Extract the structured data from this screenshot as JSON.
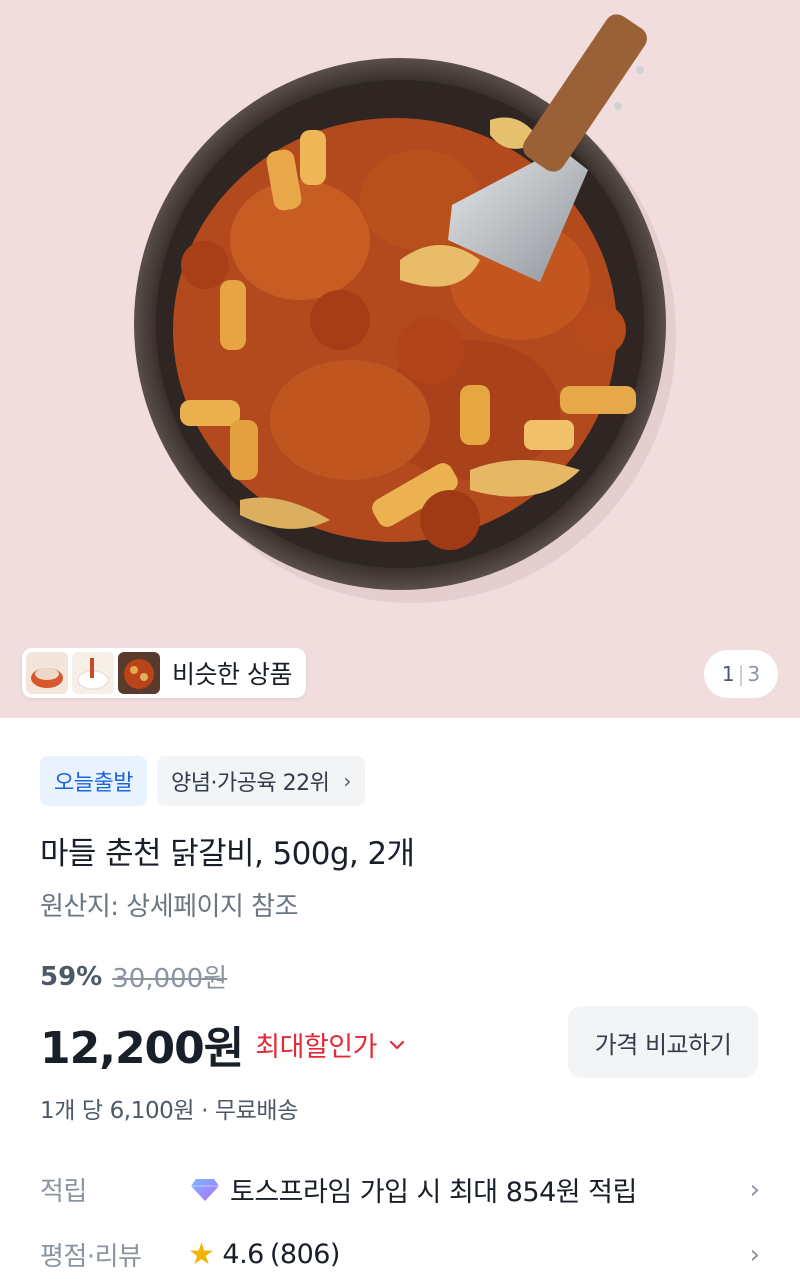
{
  "hero": {
    "similar_label": "비슷한 상품",
    "pager": {
      "current": "1",
      "separator": "|",
      "total": "3"
    }
  },
  "badges": {
    "today": "오늘출발",
    "rank": "양념·가공육 22위",
    "rank_chevron": "›"
  },
  "product": {
    "title": "마들 춘천 닭갈비, 500g, 2개",
    "origin": "원산지: 상세페이지 참조"
  },
  "pricing": {
    "discount_rate": "59%",
    "original_price": "30,000원",
    "price": "12,200원",
    "max_discount_label": "최대할인가",
    "max_discount_chevron": "⌄",
    "compare_button": "가격 비교하기",
    "unit_info": "1개 당 6,100원 · 무료배송"
  },
  "points": {
    "key": "적립",
    "icon": "toss-prime-gem-icon",
    "text": "토스프라임 가입 시 최대 854원 적립",
    "arrow": "›"
  },
  "review": {
    "key": "평점·리뷰",
    "icon": "star-icon",
    "rating": "4.6",
    "count": "(806)",
    "arrow": "›"
  },
  "colors": {
    "hero_background": "#f1dcde",
    "badge_today_bg": "#e8f3ff",
    "badge_today_text": "#1b64da",
    "max_discount": "#e42939",
    "star": "#f5b400"
  }
}
